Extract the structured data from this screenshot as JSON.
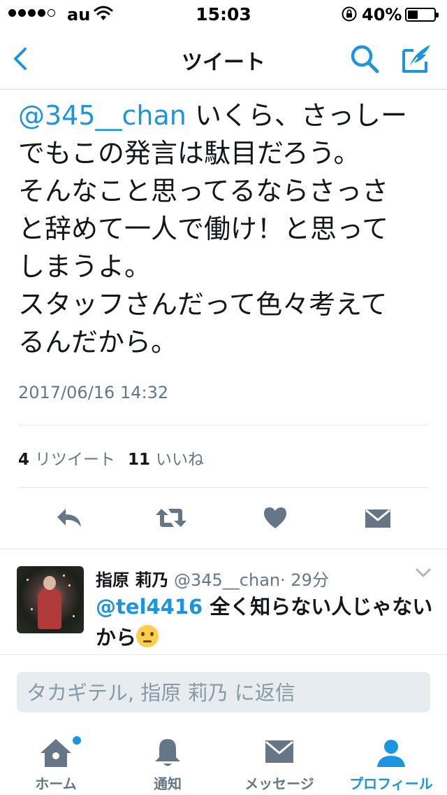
{
  "status_bar": {
    "carrier": "au",
    "time": "15:03",
    "battery": "40%",
    "battery_level": 0.4
  },
  "nav": {
    "title": "ツイート"
  },
  "tweet": {
    "mention": "@345__chan",
    "body": " いくら、さっしー\nでもこの発言は駄目だろう。\nそんなこと思ってるならさっさ\nと辞めて一人で働け！と思って\nしまうよ。\nスタッフさんだって色々考えて\nるんだから。",
    "timestamp": "2017/06/16 14:32",
    "retweet_count": "4",
    "retweet_label": "リツイート",
    "like_count": "11",
    "like_label": "いいね"
  },
  "actions": [
    "reply-icon",
    "retweet-icon",
    "heart-icon",
    "direct-message-icon"
  ],
  "reply": {
    "name": "指原 莉乃",
    "handle": "@345__chan",
    "time": "· 29分",
    "mention": "@tel4416",
    "text_line1": " 全く知らない人じゃない",
    "text_line2": "から",
    "emoji": "thinking-face-emoji"
  },
  "reply_input": {
    "placeholder": "タカギテル, 指原 莉乃 に返信",
    "value": ""
  },
  "tabs": [
    {
      "label": "ホーム",
      "icon": "home-icon"
    },
    {
      "label": "通知",
      "icon": "bell-icon"
    },
    {
      "label": "メッセージ",
      "icon": "envelope-icon"
    },
    {
      "label": "プロフィール",
      "icon": "profile-icon"
    }
  ],
  "colors": {
    "accent": "#1b95e0",
    "secondary_text": "#657786",
    "icon_gray": "#657786"
  }
}
